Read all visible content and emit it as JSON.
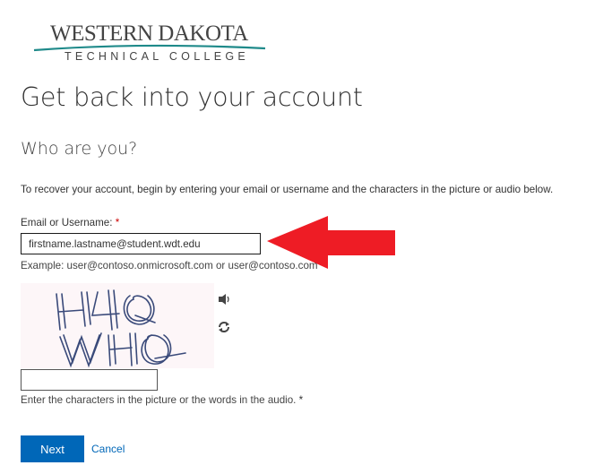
{
  "logo": {
    "top": "WESTERN DAKOTA",
    "bottom": "TECHNICAL COLLEGE",
    "accent": "#1f8a8a"
  },
  "page": {
    "title": "Get back into your account",
    "subtitle": "Who are you?",
    "instructions": "To recover your account, begin by entering your email or username and the characters in the picture or audio below."
  },
  "email": {
    "label": "Email or Username:",
    "required_mark": "*",
    "value": "firstname.lastname@student.wdt.edu",
    "example": "Example: user@contoso.onmicrosoft.com or user@contoso.com"
  },
  "captcha": {
    "text": "H4Q WHQ",
    "audio_icon": "speaker-icon",
    "refresh_icon": "refresh-icon",
    "input_value": "",
    "hint": "Enter the characters in the picture or the words in the audio.",
    "required_mark": "*"
  },
  "actions": {
    "next": "Next",
    "cancel": "Cancel",
    "primary_color": "#0067b8"
  },
  "annotation": {
    "arrow_color": "#ee1c25"
  }
}
